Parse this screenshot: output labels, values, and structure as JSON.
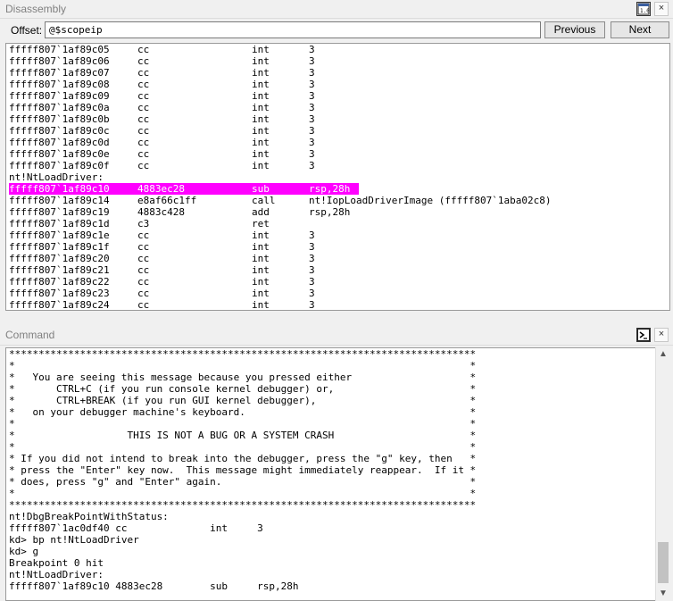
{
  "disassembly": {
    "title": "Disassembly",
    "offset_label": "Offset:",
    "offset_value": "@$scopeip",
    "previous_label": "Previous",
    "next_label": "Next",
    "lines": [
      {
        "addr": "fffff807`1af89c05",
        "bytes": "cc",
        "mnem": "int",
        "ops": "3"
      },
      {
        "addr": "fffff807`1af89c06",
        "bytes": "cc",
        "mnem": "int",
        "ops": "3"
      },
      {
        "addr": "fffff807`1af89c07",
        "bytes": "cc",
        "mnem": "int",
        "ops": "3"
      },
      {
        "addr": "fffff807`1af89c08",
        "bytes": "cc",
        "mnem": "int",
        "ops": "3"
      },
      {
        "addr": "fffff807`1af89c09",
        "bytes": "cc",
        "mnem": "int",
        "ops": "3"
      },
      {
        "addr": "fffff807`1af89c0a",
        "bytes": "cc",
        "mnem": "int",
        "ops": "3"
      },
      {
        "addr": "fffff807`1af89c0b",
        "bytes": "cc",
        "mnem": "int",
        "ops": "3"
      },
      {
        "addr": "fffff807`1af89c0c",
        "bytes": "cc",
        "mnem": "int",
        "ops": "3"
      },
      {
        "addr": "fffff807`1af89c0d",
        "bytes": "cc",
        "mnem": "int",
        "ops": "3"
      },
      {
        "addr": "fffff807`1af89c0e",
        "bytes": "cc",
        "mnem": "int",
        "ops": "3"
      },
      {
        "addr": "fffff807`1af89c0f",
        "bytes": "cc",
        "mnem": "int",
        "ops": "3"
      },
      {
        "label": "nt!NtLoadDriver:"
      },
      {
        "addr": "fffff807`1af89c10",
        "bytes": "4883ec28",
        "mnem": "sub",
        "ops": "rsp,28h",
        "highlight": true
      },
      {
        "addr": "fffff807`1af89c14",
        "bytes": "e8af66c1ff",
        "mnem": "call",
        "ops": "nt!IopLoadDriverImage (fffff807`1aba02c8)"
      },
      {
        "addr": "fffff807`1af89c19",
        "bytes": "4883c428",
        "mnem": "add",
        "ops": "rsp,28h"
      },
      {
        "addr": "fffff807`1af89c1d",
        "bytes": "c3",
        "mnem": "ret",
        "ops": ""
      },
      {
        "addr": "fffff807`1af89c1e",
        "bytes": "cc",
        "mnem": "int",
        "ops": "3"
      },
      {
        "addr": "fffff807`1af89c1f",
        "bytes": "cc",
        "mnem": "int",
        "ops": "3"
      },
      {
        "addr": "fffff807`1af89c20",
        "bytes": "cc",
        "mnem": "int",
        "ops": "3"
      },
      {
        "addr": "fffff807`1af89c21",
        "bytes": "cc",
        "mnem": "int",
        "ops": "3"
      },
      {
        "addr": "fffff807`1af89c22",
        "bytes": "cc",
        "mnem": "int",
        "ops": "3"
      },
      {
        "addr": "fffff807`1af89c23",
        "bytes": "cc",
        "mnem": "int",
        "ops": "3"
      },
      {
        "addr": "fffff807`1af89c24",
        "bytes": "cc",
        "mnem": "int",
        "ops": "3"
      }
    ]
  },
  "command": {
    "title": "Command",
    "lines": [
      "*******************************************************************************",
      "*                                                                             *",
      "*   You are seeing this message because you pressed either                    *",
      "*       CTRL+C (if you run console kernel debugger) or,                       *",
      "*       CTRL+BREAK (if you run GUI kernel debugger),                          *",
      "*   on your debugger machine's keyboard.                                      *",
      "*                                                                             *",
      "*                   THIS IS NOT A BUG OR A SYSTEM CRASH                       *",
      "*                                                                             *",
      "* If you did not intend to break into the debugger, press the \"g\" key, then   *",
      "* press the \"Enter\" key now.  This message might immediately reappear.  If it *",
      "* does, press \"g\" and \"Enter\" again.                                          *",
      "*                                                                             *",
      "*******************************************************************************",
      "nt!DbgBreakPointWithStatus:",
      "fffff807`1ac0df40 cc              int     3",
      "kd> bp nt!NtLoadDriver",
      "kd> g",
      "Breakpoint 0 hit",
      "nt!NtLoadDriver:",
      "fffff807`1af89c10 4883ec28        sub     rsp,28h"
    ]
  },
  "icons": {
    "window_icon": "disassembly-window-icon",
    "command_icon": "command-prompt-icon",
    "close": "close-icon"
  },
  "colors": {
    "highlight_bg": "#ff00ff",
    "highlight_fg": "#ffffff"
  }
}
